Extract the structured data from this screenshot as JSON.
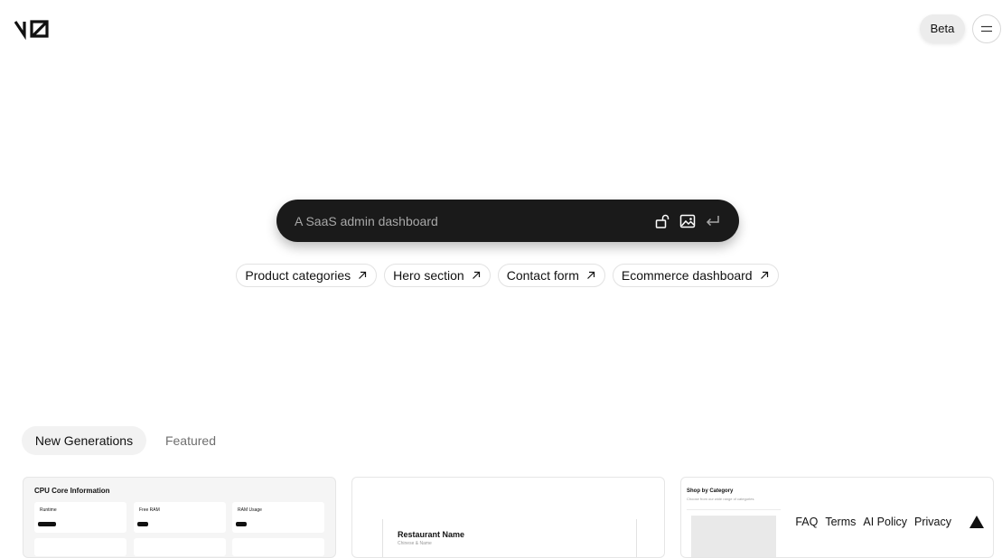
{
  "header": {
    "logo_icon": "v0-logo-icon",
    "beta_label": "Beta",
    "menu_icon": "menu-icon"
  },
  "prompt": {
    "placeholder": "A SaaS admin dashboard",
    "icons": [
      "lock-open-icon",
      "image-icon",
      "enter-icon"
    ]
  },
  "suggestions": [
    {
      "label": "Product categories",
      "icon": "arrow-up-right-icon"
    },
    {
      "label": "Hero section",
      "icon": "arrow-up-right-icon"
    },
    {
      "label": "Contact form",
      "icon": "arrow-up-right-icon"
    },
    {
      "label": "Ecommerce dashboard",
      "icon": "arrow-up-right-icon"
    }
  ],
  "tabs": [
    {
      "label": "New Generations",
      "active": true
    },
    {
      "label": "Featured",
      "active": false
    }
  ],
  "gallery": [
    {
      "title": "CPU Core Information",
      "panels": [
        {
          "label": "Runtime"
        },
        {
          "label": "Free RAM"
        },
        {
          "label": "RAM Usage"
        }
      ]
    },
    {
      "title": "Restaurant Name",
      "subtitle": "Chinese & Name"
    },
    {
      "title": "Shop by Category",
      "subtitle": "Choose from our wide range of categories"
    }
  ],
  "footer": {
    "links": [
      "FAQ",
      "Terms",
      "AI Policy",
      "Privacy"
    ],
    "brand_icon": "vercel-triangle-icon"
  },
  "colors": {
    "prompt_bg": "#1a1a1a",
    "tab_active_bg": "#f2f2f2",
    "text": "#111111",
    "muted": "#6f6f6f"
  }
}
